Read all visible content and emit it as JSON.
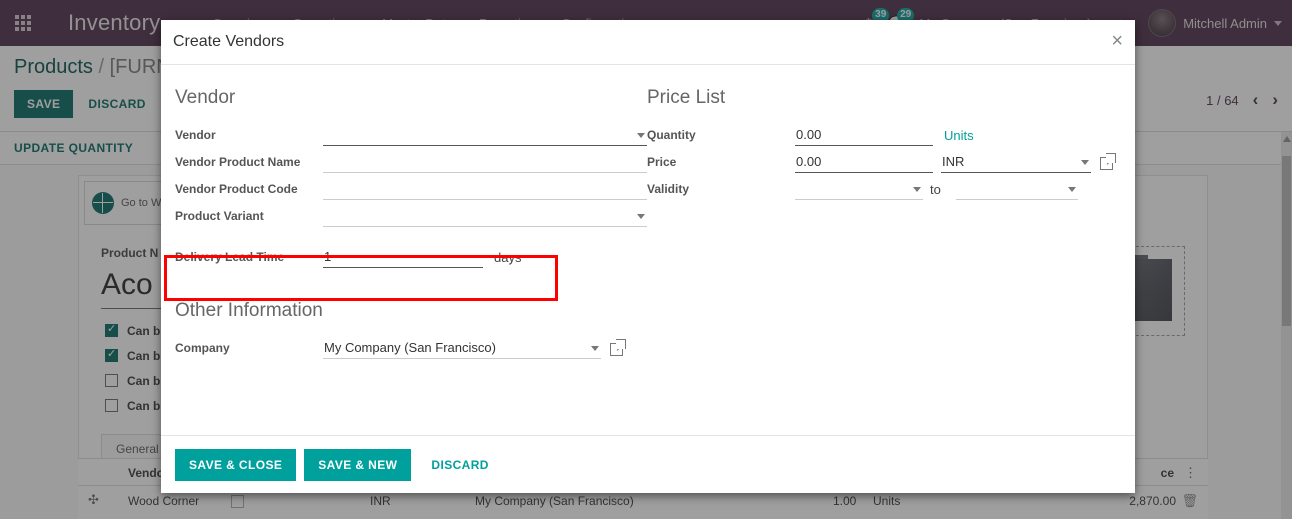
{
  "navbar": {
    "apps_icon": "apps-grid-icon",
    "brand": "Inventory",
    "menu": [
      "Overview",
      "Operations",
      "Master Data",
      "Reporting",
      "Configuration"
    ],
    "activity_badge": "39",
    "messages_badge": "29",
    "company_selector": "My Company (San Francisco)",
    "shortcut_icon": "scissors-icon",
    "user_name": "Mitchell Admin"
  },
  "control_panel": {
    "breadcrumb_root": "Products",
    "breadcrumb_sep": "/",
    "breadcrumb_current": "[FURN_",
    "save_label": "SAVE",
    "discard_label": "DISCARD",
    "pager_text": "1 / 64",
    "prev_icon": "chevron-left-icon",
    "next_icon": "chevron-right-icon",
    "update_quantity_label": "UPDATE QUANTITY"
  },
  "record": {
    "go_to_website": "Go to Website",
    "product_name_label": "Product N",
    "product_name_value": "Aco",
    "checkboxes": [
      {
        "label": "Can b",
        "checked": true
      },
      {
        "label": "Can b",
        "checked": true
      },
      {
        "label": "Can b",
        "checked": false
      },
      {
        "label": "Can b",
        "checked": false
      }
    ],
    "tab_general": "General"
  },
  "vendor_grid": {
    "columns": [
      "Vendor",
      "",
      "",
      "",
      "",
      "ce"
    ],
    "options_icon": "vertical-dots-icon",
    "row": {
      "drag_icon": "drag-handle-icon",
      "vendor": "Wood Corner",
      "currency": "INR",
      "company": "My Company (San Francisco)",
      "quantity": "1.00",
      "uom": "Units",
      "price": "2,870.00",
      "delete_icon": "trash-icon"
    }
  },
  "modal": {
    "title": "Create Vendors",
    "close_icon": "close-icon",
    "vendor_group": {
      "title": "Vendor",
      "fields": [
        {
          "label": "Vendor",
          "value": "",
          "type": "select"
        },
        {
          "label": "Vendor Product Name",
          "value": "",
          "type": "text"
        },
        {
          "label": "Vendor Product Code",
          "value": "",
          "type": "text"
        },
        {
          "label": "Product Variant",
          "value": "",
          "type": "select"
        },
        {
          "label": "Delivery Lead Time",
          "value": "1",
          "type": "number",
          "suffix": "days"
        }
      ]
    },
    "price_list_group": {
      "title": "Price List",
      "quantity_label": "Quantity",
      "quantity_value": "0.00",
      "quantity_uom": "Units",
      "price_label": "Price",
      "price_value": "0.00",
      "currency_value": "INR",
      "currency_link_icon": "external-link-icon",
      "validity_label": "Validity",
      "validity_from": "",
      "validity_to_word": "to",
      "validity_to": ""
    },
    "other_group": {
      "title": "Other Information",
      "company_label": "Company",
      "company_value": "My Company (San Francisco)",
      "company_link_icon": "external-link-icon"
    },
    "footer": {
      "save_close": "SAVE & CLOSE",
      "save_new": "SAVE & NEW",
      "discard": "DISCARD"
    }
  },
  "annotation": {
    "highlight_color": "#ff0000",
    "highlight_target": "delivery-lead-time-row"
  },
  "colors": {
    "navbar": "#4a2a46",
    "primary": "#00665e",
    "accent": "#00a09d"
  }
}
